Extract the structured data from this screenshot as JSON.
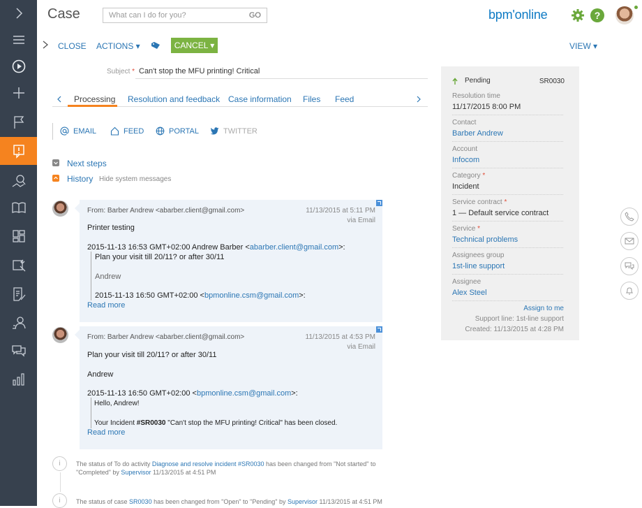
{
  "header": {
    "title": "Case",
    "command_placeholder": "What can I do for you?",
    "command_go": "GO",
    "brand": "bpm'online"
  },
  "toolbar": {
    "close": "CLOSE",
    "actions": "ACTIONS ▾",
    "cancel": "CANCEL ▾",
    "view": "VIEW ▾"
  },
  "subject": {
    "label": "Subject",
    "value": "Can't stop the MFU printing! Critical"
  },
  "tabs": [
    "Processing",
    "Resolution and feedback",
    "Case information",
    "Files",
    "Feed"
  ],
  "channels": [
    "EMAIL",
    "FEED",
    "PORTAL",
    "TWITTER"
  ],
  "sections": {
    "next_steps": "Next steps",
    "history": "History",
    "hide_system": "Hide system messages"
  },
  "messages": [
    {
      "from": "From: Barber Andrew <abarber.client@gmail.com>",
      "date": "11/13/2015 at 5:11 PM",
      "via": "via Email",
      "first": "Printer testing",
      "header_pre": "2015-11-13 16:53 GMT+02:00 Andrew Barber <",
      "header_link": "abarber.client@gmail.com",
      "header_post": ">:",
      "q1": "Plan your visit till 20/11? or after 30/11",
      "q2": "Andrew",
      "q3_pre": "2015-11-13 16:50 GMT+02:00 <",
      "q3_link": "bpmonline.csm@gmail.com",
      "q3_post": ">:",
      "more": "Read more"
    },
    {
      "from": "From: Barber Andrew <abarber.client@gmail.com>",
      "date": "11/13/2015 at 4:53 PM",
      "via": "via Email",
      "first": "Plan your visit till 20/11? or after 30/11",
      "second": "Andrew",
      "header_pre": "2015-11-13 16:50 GMT+02:00 <",
      "header_link": "bpmonline.csm@gmail.com",
      "header_post": ">:",
      "q1": "Hello, Andrew!",
      "q2_pre": "Your Incident ",
      "q2_bold": "#SR0030",
      "q2_post": " \"Can't stop the MFU printing! Critical\" has been closed.",
      "more": "Read more"
    }
  ],
  "notes": [
    {
      "pre": "The status of To do activity ",
      "link1": "Diagnose and resolve incident #SR0030",
      "mid": " has been changed from \"Not started\" to \"Completed\" by ",
      "link2": "Supervisor",
      "post": " 11/13/2015 at 4:51 PM"
    },
    {
      "pre": "The status of case ",
      "link1": "SR0030",
      "mid": " has been changed from \"Open\" to \"Pending\" by ",
      "link2": "Supervisor",
      "post": " 11/13/2015 at 4:51 PM"
    }
  ],
  "panel": {
    "status": "Pending",
    "code": "SR0030",
    "fields": [
      {
        "label": "Resolution time",
        "value": "11/17/2015 8:00 PM",
        "link": false,
        "required": false
      },
      {
        "label": "Contact",
        "value": "Barber Andrew",
        "link": true,
        "required": false
      },
      {
        "label": "Account",
        "value": "Infocom",
        "link": true,
        "required": false
      },
      {
        "label": "Category",
        "value": "Incident",
        "link": false,
        "required": true
      },
      {
        "label": "Service contract",
        "value": "1 — Default service contract",
        "link": false,
        "required": true
      },
      {
        "label": "Service",
        "value": "Technical problems",
        "link": true,
        "required": true
      },
      {
        "label": "Assignees group",
        "value": "1st-line support",
        "link": true,
        "required": false
      },
      {
        "label": "Assignee",
        "value": "Alex Steel",
        "link": true,
        "required": false
      }
    ],
    "assign_me": "Assign to me",
    "support_line": "Support line: 1st-line support",
    "created": "Created: 11/13/2015 at 4:28 PM"
  },
  "colors": {
    "rail": "#37414e",
    "active_nav": "#f5831f",
    "cancel_button": "#7cb342",
    "link": "#2b76b4",
    "card": "#eef3f9",
    "panel": "#f0f0f0"
  },
  "icons": {
    "rail": [
      "chevron-right-icon",
      "menu-icon",
      "play-icon",
      "plus-icon",
      "flag-icon",
      "case-icon",
      "search-map-icon",
      "book-icon",
      "dashboard-icon",
      "tools-icon",
      "document-icon",
      "users-icon",
      "chat-icon",
      "analytics-icon"
    ],
    "right": [
      "phone-icon",
      "mail-icon",
      "chat-bubbles-icon",
      "bell-icon"
    ]
  }
}
